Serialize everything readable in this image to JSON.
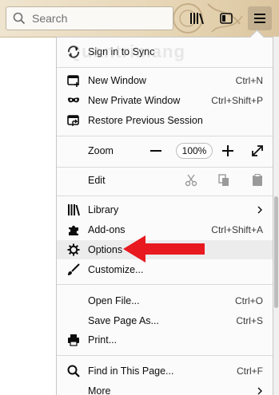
{
  "toolbar": {
    "search_placeholder": "Search"
  },
  "watermark": "Quantrimang",
  "menu": {
    "sync": "Sign in to Sync",
    "new_window": {
      "label": "New Window",
      "shortcut": "Ctrl+N"
    },
    "private_window": {
      "label": "New Private Window",
      "shortcut": "Ctrl+Shift+P"
    },
    "restore_session": {
      "label": "Restore Previous Session"
    },
    "zoom": {
      "label": "Zoom",
      "value": "100%",
      "minus": "—",
      "plus": "+"
    },
    "edit": {
      "label": "Edit"
    },
    "library": {
      "label": "Library"
    },
    "addons": {
      "label": "Add-ons",
      "shortcut": "Ctrl+Shift+A"
    },
    "options": {
      "label": "Options"
    },
    "customize": {
      "label": "Customize..."
    },
    "open_file": {
      "label": "Open File...",
      "shortcut": "Ctrl+O"
    },
    "save_page": {
      "label": "Save Page As...",
      "shortcut": "Ctrl+S"
    },
    "print": {
      "label": "Print..."
    },
    "find": {
      "label": "Find in This Page...",
      "shortcut": "Ctrl+F"
    },
    "more": {
      "label": "More"
    }
  },
  "colors": {
    "annotation_arrow": "#e8191f",
    "highlight": "#ececec"
  }
}
